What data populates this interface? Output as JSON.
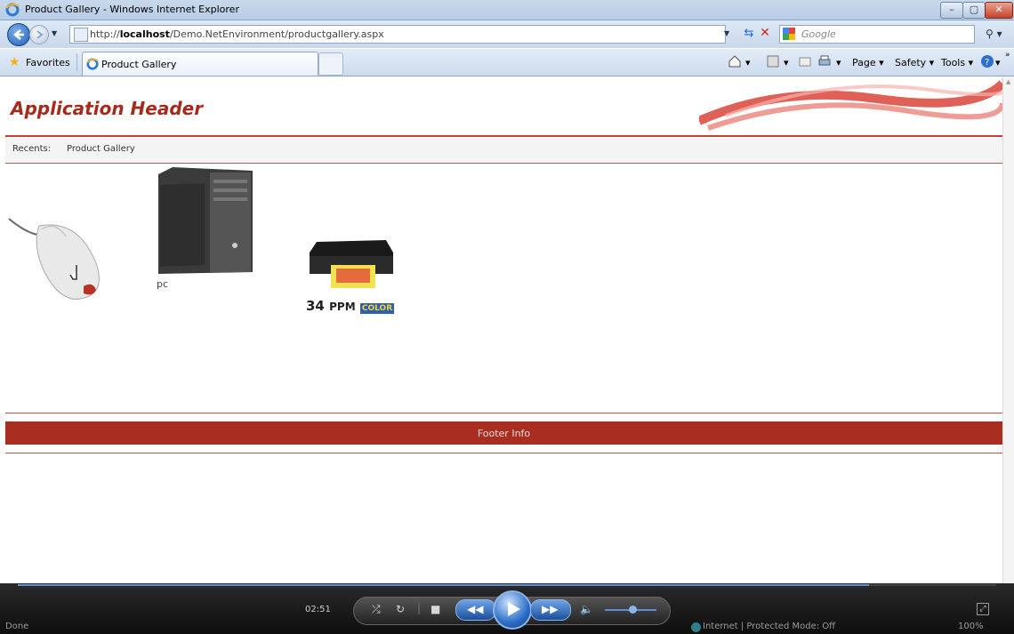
{
  "window": {
    "title": "Product Gallery - Windows Internet Explorer",
    "minimize": "–",
    "maximize": "▢",
    "close": "✕"
  },
  "address": {
    "url_prefix": "http://",
    "url_host": "localhost",
    "url_path": "/Demo.NetEnvironment/productgallery.aspx",
    "search_placeholder": "Google"
  },
  "favorites": {
    "label": "Favorites",
    "tab_label": "Product Gallery"
  },
  "commands": {
    "page": "Page ▾",
    "safety": "Safety ▾",
    "tools": "Tools ▾"
  },
  "page": {
    "header_title": "Application Header",
    "recents_label": "Recents:",
    "recents_link": "Product Gallery",
    "products": [
      {
        "name": "mouse",
        "caption": ""
      },
      {
        "name": "pc",
        "caption": "pc"
      },
      {
        "name": "printer",
        "caption": ""
      }
    ],
    "printer_speed": "34",
    "printer_unit": "PPM",
    "printer_badge": "COLOR",
    "footer": "Footer Info"
  },
  "player": {
    "time": "02:51",
    "progress_percent": 87
  },
  "status": {
    "left": "Done",
    "zone": "Internet | Protected Mode: Off",
    "zoom": "100%"
  },
  "colors": {
    "brand_red": "#a92d20",
    "header_text": "#a52a1c",
    "ie_chrome": "#c9d9ec"
  }
}
